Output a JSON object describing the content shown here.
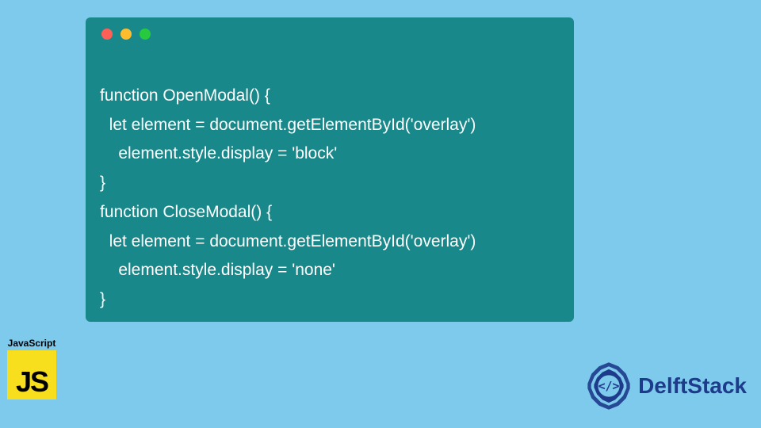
{
  "code": {
    "lines": [
      "function OpenModal() {",
      "  let element = document.getElementById('overlay')",
      "    element.style.display = 'block'",
      "}",
      "function CloseModal() {",
      "  let element = document.getElementById('overlay')",
      "    element.style.display = 'none'",
      "}"
    ]
  },
  "badges": {
    "js_label": "JavaScript",
    "js_logo_text": "JS",
    "brand": "DelftStack"
  },
  "colors": {
    "background": "#7ecaed",
    "window": "#19888a",
    "js_yellow": "#f7df1e",
    "brand_blue": "#1e3a8a"
  }
}
